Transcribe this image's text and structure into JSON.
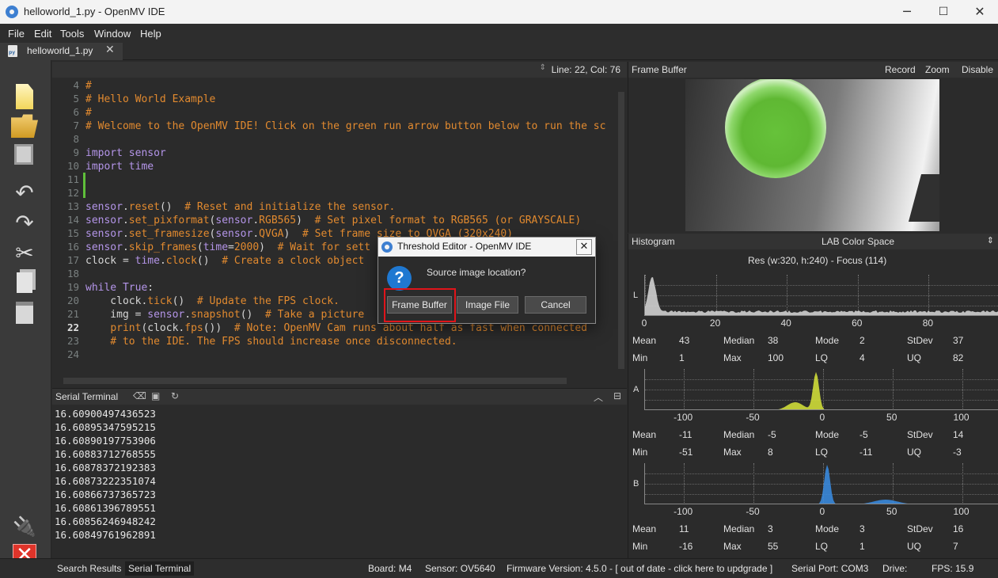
{
  "window": {
    "title": "helloworld_1.py - OpenMV IDE",
    "minimize": "─",
    "maximize": "☐",
    "close": "✕"
  },
  "menu": [
    "File",
    "Edit",
    "Tools",
    "Window",
    "Help"
  ],
  "tab": {
    "label": "helloworld_1.py",
    "close": "✕"
  },
  "toolbar": {
    "icons": [
      "new-file-icon",
      "open-folder-icon",
      "save-icon",
      "undo-icon",
      "redo-icon",
      "cut-icon",
      "copy-icon",
      "paste-icon",
      "connect-icon",
      "stop-icon"
    ]
  },
  "editor": {
    "position": "Line: 22, Col: 76",
    "current_line": 22,
    "lines": [
      {
        "n": "4",
        "code": [
          {
            "t": "#",
            "c": "com"
          }
        ]
      },
      {
        "n": "5",
        "code": [
          {
            "t": "# Hello World Example",
            "c": "com"
          }
        ]
      },
      {
        "n": "6",
        "code": [
          {
            "t": "#",
            "c": "com"
          }
        ]
      },
      {
        "n": "7",
        "code": [
          {
            "t": "# Welcome to the OpenMV IDE! Click on the green run arrow button below to run the sc",
            "c": "com"
          }
        ]
      },
      {
        "n": "8",
        "code": []
      },
      {
        "n": "9",
        "code": [
          {
            "t": "import",
            "c": "kw"
          },
          {
            "t": " sensor",
            "c": "mod"
          }
        ]
      },
      {
        "n": "10",
        "code": [
          {
            "t": "import",
            "c": "kw"
          },
          {
            "t": " time",
            "c": "mod"
          }
        ]
      },
      {
        "n": "11",
        "code": []
      },
      {
        "n": "12",
        "code": []
      },
      {
        "n": "13",
        "code": [
          {
            "t": "sensor",
            "c": "mod"
          },
          {
            "t": ".",
            "c": "def"
          },
          {
            "t": "reset",
            "c": "fn"
          },
          {
            "t": "()  ",
            "c": "def"
          },
          {
            "t": "# Reset and initialize the sensor.",
            "c": "com"
          }
        ]
      },
      {
        "n": "14",
        "code": [
          {
            "t": "sensor",
            "c": "mod"
          },
          {
            "t": ".",
            "c": "def"
          },
          {
            "t": "set_pixformat",
            "c": "fn"
          },
          {
            "t": "(",
            "c": "def"
          },
          {
            "t": "sensor",
            "c": "mod"
          },
          {
            "t": ".",
            "c": "def"
          },
          {
            "t": "RGB565",
            "c": "fn"
          },
          {
            "t": ")  ",
            "c": "def"
          },
          {
            "t": "# Set pixel format to RGB565 (or GRAYSCALE)",
            "c": "com"
          }
        ]
      },
      {
        "n": "15",
        "code": [
          {
            "t": "sensor",
            "c": "mod"
          },
          {
            "t": ".",
            "c": "def"
          },
          {
            "t": "set_framesize",
            "c": "fn"
          },
          {
            "t": "(",
            "c": "def"
          },
          {
            "t": "sensor",
            "c": "mod"
          },
          {
            "t": ".",
            "c": "def"
          },
          {
            "t": "QVGA",
            "c": "fn"
          },
          {
            "t": ")  ",
            "c": "def"
          },
          {
            "t": "# Set frame size to QVGA (320x240)",
            "c": "com"
          }
        ]
      },
      {
        "n": "16",
        "code": [
          {
            "t": "sensor",
            "c": "mod"
          },
          {
            "t": ".",
            "c": "def"
          },
          {
            "t": "skip_frames",
            "c": "fn"
          },
          {
            "t": "(",
            "c": "def"
          },
          {
            "t": "time",
            "c": "mod"
          },
          {
            "t": "=",
            "c": "def"
          },
          {
            "t": "2000",
            "c": "num"
          },
          {
            "t": ")  ",
            "c": "def"
          },
          {
            "t": "# Wait for sett",
            "c": "com"
          }
        ]
      },
      {
        "n": "17",
        "code": [
          {
            "t": "clock = ",
            "c": "def"
          },
          {
            "t": "time",
            "c": "mod"
          },
          {
            "t": ".",
            "c": "def"
          },
          {
            "t": "clock",
            "c": "fn"
          },
          {
            "t": "()  ",
            "c": "def"
          },
          {
            "t": "# Create a clock object",
            "c": "com"
          }
        ]
      },
      {
        "n": "18",
        "code": []
      },
      {
        "n": "19",
        "code": [
          {
            "t": "while",
            "c": "kw"
          },
          {
            "t": " ",
            "c": "def"
          },
          {
            "t": "True",
            "c": "kw"
          },
          {
            "t": ":",
            "c": "def"
          }
        ]
      },
      {
        "n": "20",
        "code": [
          {
            "t": "    clock.",
            "c": "def"
          },
          {
            "t": "tick",
            "c": "fn"
          },
          {
            "t": "()  ",
            "c": "def"
          },
          {
            "t": "# Update the FPS clock.",
            "c": "com"
          }
        ]
      },
      {
        "n": "21",
        "code": [
          {
            "t": "    img = ",
            "c": "def"
          },
          {
            "t": "sensor",
            "c": "mod"
          },
          {
            "t": ".",
            "c": "def"
          },
          {
            "t": "snapshot",
            "c": "fn"
          },
          {
            "t": "()  ",
            "c": "def"
          },
          {
            "t": "# Take a picture",
            "c": "com"
          }
        ]
      },
      {
        "n": "22",
        "code": [
          {
            "t": "    ",
            "c": "def"
          },
          {
            "t": "print",
            "c": "fn"
          },
          {
            "t": "(clock.",
            "c": "def"
          },
          {
            "t": "fps",
            "c": "fn"
          },
          {
            "t": "())  ",
            "c": "def"
          },
          {
            "t": "# Note: OpenMV Cam runs about half as fast when connected",
            "c": "com"
          }
        ]
      },
      {
        "n": "23",
        "code": [
          {
            "t": "    # to the IDE. The FPS should increase once disconnected.",
            "c": "com"
          }
        ]
      },
      {
        "n": "24",
        "code": []
      }
    ]
  },
  "serial": {
    "title": "Serial Terminal",
    "lines": [
      "16.60900497436523",
      "16.60895347595215",
      "16.60890197753906",
      "16.60883712768555",
      "16.60878372192383",
      "16.60873222351074",
      "16.60866737365723",
      "16.60861396789551",
      "16.60856246948242",
      "16.60849761962891"
    ]
  },
  "status": {
    "search_results": "Search Results",
    "serial_terminal": "Serial Terminal",
    "board": "Board: M4",
    "sensor": "Sensor: OV5640",
    "firmware": "Firmware Version: 4.5.0 - [ out of date - click here to updgrade ]",
    "serial_port": "Serial Port: COM3",
    "drive": "Drive:",
    "fps": "FPS: 15.9"
  },
  "frame_buffer": {
    "title": "Frame Buffer",
    "record": "Record",
    "zoom": "Zoom",
    "disable": "Disable"
  },
  "histogram": {
    "title": "Histogram",
    "color_space": "LAB Color Space",
    "res": "Res (w:320, h:240) - Focus (114)",
    "channels": [
      {
        "axis": "L",
        "color": "#d9d9d9",
        "ticks": [
          "0",
          "20",
          "40",
          "60",
          "80"
        ],
        "range": [
          0,
          100
        ],
        "stats": {
          "mean": "43",
          "median": "38",
          "mode": "2",
          "stdev": "37",
          "min": "1",
          "max": "100",
          "lq": "4",
          "uq": "82"
        }
      },
      {
        "axis": "A",
        "color": "#d8e63a",
        "ticks": [
          "-100",
          "-50",
          "0",
          "50",
          "100"
        ],
        "range": [
          -128,
          127
        ],
        "stats": {
          "mean": "-11",
          "median": "-5",
          "mode": "-5",
          "stdev": "14",
          "min": "-51",
          "max": "8",
          "lq": "-11",
          "uq": "-3"
        }
      },
      {
        "axis": "B",
        "color": "#3a8ee6",
        "ticks": [
          "-100",
          "-50",
          "0",
          "50",
          "100"
        ],
        "range": [
          -128,
          127
        ],
        "stats": {
          "mean": "11",
          "median": "3",
          "mode": "3",
          "stdev": "16",
          "min": "-16",
          "max": "55",
          "lq": "1",
          "uq": "7"
        }
      }
    ],
    "stat_labels": {
      "mean": "Mean",
      "median": "Median",
      "mode": "Mode",
      "stdev": "StDev",
      "min": "Min",
      "max": "Max",
      "lq": "LQ",
      "uq": "UQ"
    }
  },
  "dialog": {
    "title": "Threshold Editor - OpenMV IDE",
    "close": "✕",
    "icon": "?",
    "message": "Source image location?",
    "buttons": {
      "frame_buffer": "Frame Buffer",
      "image_file": "Image File",
      "cancel": "Cancel"
    }
  }
}
